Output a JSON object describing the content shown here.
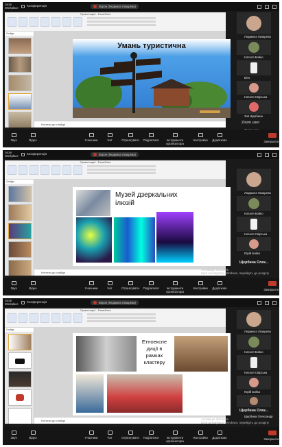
{
  "app": {
    "logo_line1": "zoom",
    "logo_line2": "Workplace",
    "tab_label": "Конференція"
  },
  "share_badge": "Ворон (Людмила Лазарева)",
  "ppt": {
    "doc_title": "Презентація1 - PowerPoint",
    "notes_placeholder": "Нотатки до слайда",
    "panel_tab": "Слайди"
  },
  "windows_watermark": {
    "line1": "Активація Windows",
    "line2": "Щоб активувати Windows, перейдіть до розділу"
  },
  "bottom_bar": {
    "audio": "Звук",
    "video": "Відео",
    "participants": "Учасники",
    "chat": "Чат",
    "react": "Отреагувати",
    "share": "Поділитися",
    "host_tools": "Інструменти організатора",
    "settings": "Настройки",
    "more": "Додатково",
    "end": "Завершити"
  },
  "frames": [
    {
      "slide": {
        "title": "Умань туристична"
      },
      "participants": [
        "Людмила Лазарева",
        "Наталя Бойко",
        "Вітя",
        "Наталя Свірська",
        "Зоя Щербина",
        "Zoom user",
        "Zoom user"
      ]
    },
    {
      "slide": {
        "title": "Музей дзеркальних ілюзій"
      },
      "participants": [
        "Людмила Лазарева",
        "Наталя Бойко",
        "Наталя Свірська",
        "Юрій Бойко",
        "Щербина Олек..."
      ]
    },
    {
      "slide": {
        "title": "Етноекспе диції в рамках кластеру"
      },
      "participants": [
        "Людмила Лазарева",
        "Наталя Бойко",
        "Наталя Свірська",
        "Юрій Бойко",
        "Щербина Олек...",
        "Щербина Олександр"
      ]
    }
  ],
  "colors": {
    "accent_selected_thumb": "#e1a53a",
    "end_red": "#c0392b",
    "sky": "#4da0e8"
  }
}
